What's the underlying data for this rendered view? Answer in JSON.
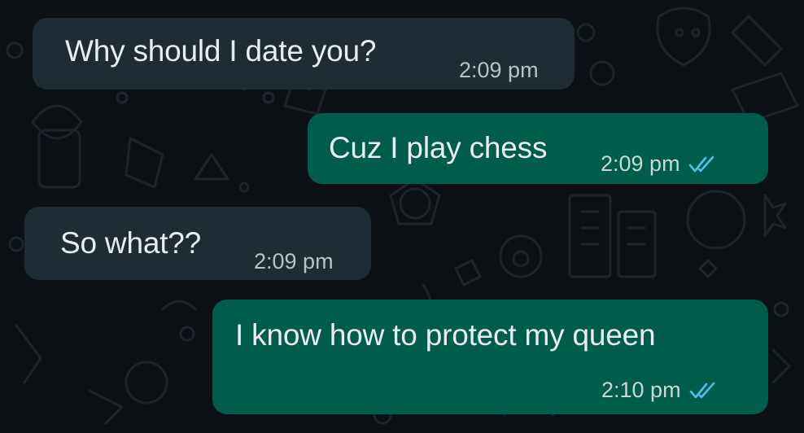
{
  "chat": {
    "messages": [
      {
        "direction": "incoming",
        "text": "Why should I date you?",
        "time": "2:09 pm"
      },
      {
        "direction": "outgoing",
        "text": "Cuz I play chess",
        "time": "2:09 pm",
        "status": "read"
      },
      {
        "direction": "incoming",
        "text": "So what??",
        "time": "2:09 pm"
      },
      {
        "direction": "outgoing",
        "text": "I know how to protect my queen",
        "time": "2:10 pm",
        "status": "read"
      }
    ]
  },
  "colors": {
    "background": "#0b1014",
    "incoming_bubble": "#202c33",
    "outgoing_bubble": "#005c4b",
    "read_ticks": "#53bdeb"
  },
  "icons": {
    "read_receipt": "double-check-icon"
  }
}
